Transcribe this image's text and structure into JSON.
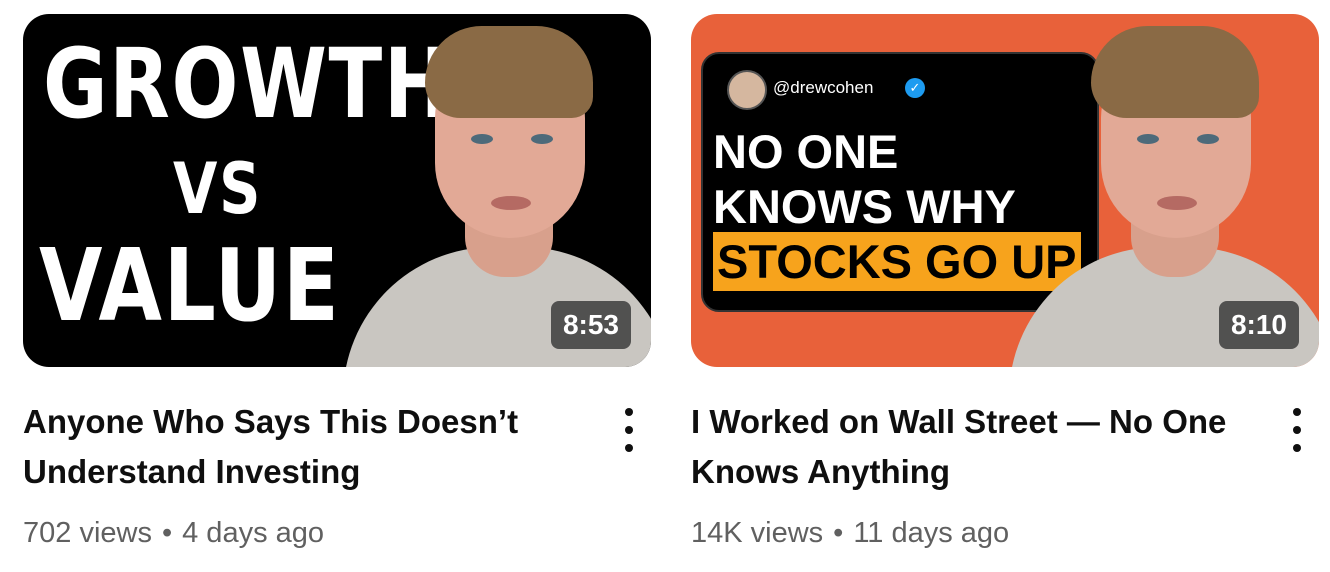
{
  "videos": [
    {
      "thumbnail_text": {
        "line1": "GROWTH",
        "line2": "VS",
        "line3": "VALUE"
      },
      "duration": "8:53",
      "title": "Anyone Who Says This Doesn’t Understand Investing",
      "views": "702 views",
      "age": "4 days ago",
      "menu_icon": "more-vert-icon"
    },
    {
      "thumbnail_text": {
        "handle": "@drewcohen",
        "line1": "NO ONE",
        "line2": "KNOWS WHY",
        "line3": "STOCKS GO UP"
      },
      "duration": "8:10",
      "title": "I Worked on Wall Street — No One Knows Anything",
      "views": "14K views",
      "age": "11 days ago",
      "menu_icon": "more-vert-icon"
    }
  ],
  "separator": "•",
  "colors": {
    "thumb2_bg": "#e8613a",
    "highlight": "#f7a31c",
    "verified": "#1d9bf0"
  }
}
